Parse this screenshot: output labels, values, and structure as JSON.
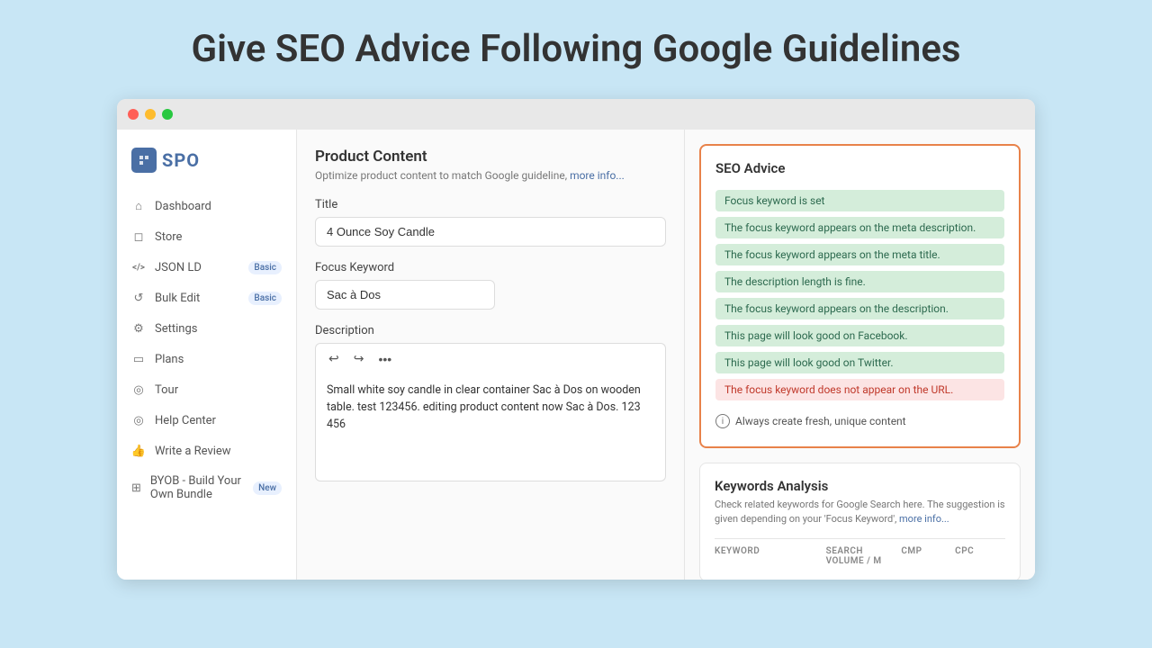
{
  "page": {
    "heading": "Give SEO Advice Following Google Guidelines"
  },
  "sidebar": {
    "logo_text": "SPO",
    "items": [
      {
        "id": "dashboard",
        "label": "Dashboard",
        "icon": "🏠",
        "badge": null
      },
      {
        "id": "store",
        "label": "Store",
        "icon": "📦",
        "badge": null
      },
      {
        "id": "json-ld",
        "label": "JSON LD",
        "icon": "</>",
        "badge": "Basic"
      },
      {
        "id": "bulk-edit",
        "label": "Bulk Edit",
        "icon": "↺",
        "badge": "Basic"
      },
      {
        "id": "settings",
        "label": "Settings",
        "icon": "⚙️",
        "badge": null
      },
      {
        "id": "plans",
        "label": "Plans",
        "icon": "💳",
        "badge": null
      },
      {
        "id": "tour",
        "label": "Tour",
        "icon": "ℹ️",
        "badge": null
      },
      {
        "id": "help-center",
        "label": "Help Center",
        "icon": "❓",
        "badge": null
      },
      {
        "id": "write-review",
        "label": "Write a Review",
        "icon": "👍",
        "badge": null
      },
      {
        "id": "byob",
        "label": "BYOB - Build Your Own Bundle",
        "icon": "🔗",
        "badge": "New"
      }
    ]
  },
  "product_content": {
    "title": "Product Content",
    "subtitle": "Optimize product content to match Google guideline,",
    "subtitle_link": "more info...",
    "title_label": "Title",
    "title_value": "4 Ounce Soy Candle",
    "focus_keyword_label": "Focus Keyword",
    "focus_keyword_value": "Sac à Dos",
    "description_label": "Description",
    "description_value": "Small white soy candle in clear container Sac à Dos on wooden table. test 123456. editing product content now Sac à Dos. 123 456",
    "toolbar": {
      "undo": "↩",
      "redo": "↪",
      "more": "•••"
    }
  },
  "seo_advice": {
    "title": "SEO Advice",
    "items": [
      {
        "text": "Focus keyword is set",
        "type": "green"
      },
      {
        "text": "The focus keyword appears on the meta description.",
        "type": "green"
      },
      {
        "text": "The focus keyword appears on the meta title.",
        "type": "green"
      },
      {
        "text": "The description length is fine.",
        "type": "green"
      },
      {
        "text": "The focus keyword appears on the description.",
        "type": "green"
      },
      {
        "text": "This page will look good on Facebook.",
        "type": "green"
      },
      {
        "text": "This page will look good on Twitter.",
        "type": "green"
      },
      {
        "text": "The focus keyword does not appear on the URL.",
        "type": "red"
      }
    ],
    "info_text": "Always create fresh, unique content"
  },
  "keywords_analysis": {
    "title": "Keywords Analysis",
    "subtitle": "Check related keywords for Google Search here. The suggestion is given depending on your 'Focus Keyword',",
    "subtitle_link": "more info...",
    "columns": [
      "KEYWORD",
      "SEARCH VOLUME / M",
      "CMP",
      "CPC"
    ]
  }
}
